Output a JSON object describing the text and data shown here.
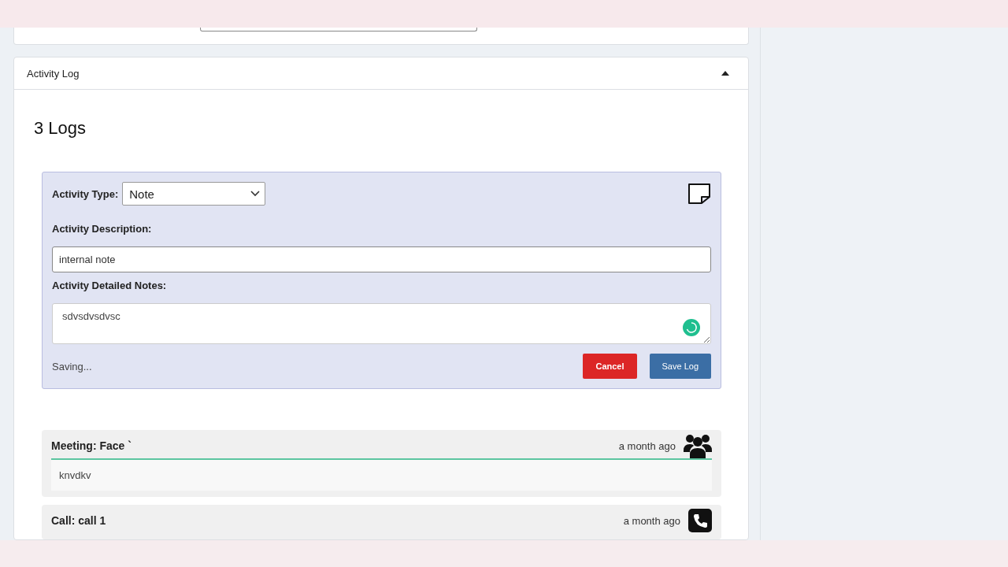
{
  "panel": {
    "title": "Activity Log",
    "expanded": true
  },
  "log_count": "3 Logs",
  "form": {
    "type_label": "Activity Type:",
    "type_value": "Note",
    "description_label": "Activity Description:",
    "description_value": "internal note",
    "notes_label": "Activity Detailed Notes:",
    "notes_value": "sdvsdvsdvsc",
    "busy": true,
    "status": "Saving...",
    "cancel": "Cancel",
    "save": "Save Log"
  },
  "logs": [
    {
      "kind": "meeting",
      "title": "Meeting: Face `",
      "time": "a month ago",
      "body": "knvdkv"
    },
    {
      "kind": "call",
      "title": "Call: call 1",
      "time": "a month ago"
    }
  ]
}
